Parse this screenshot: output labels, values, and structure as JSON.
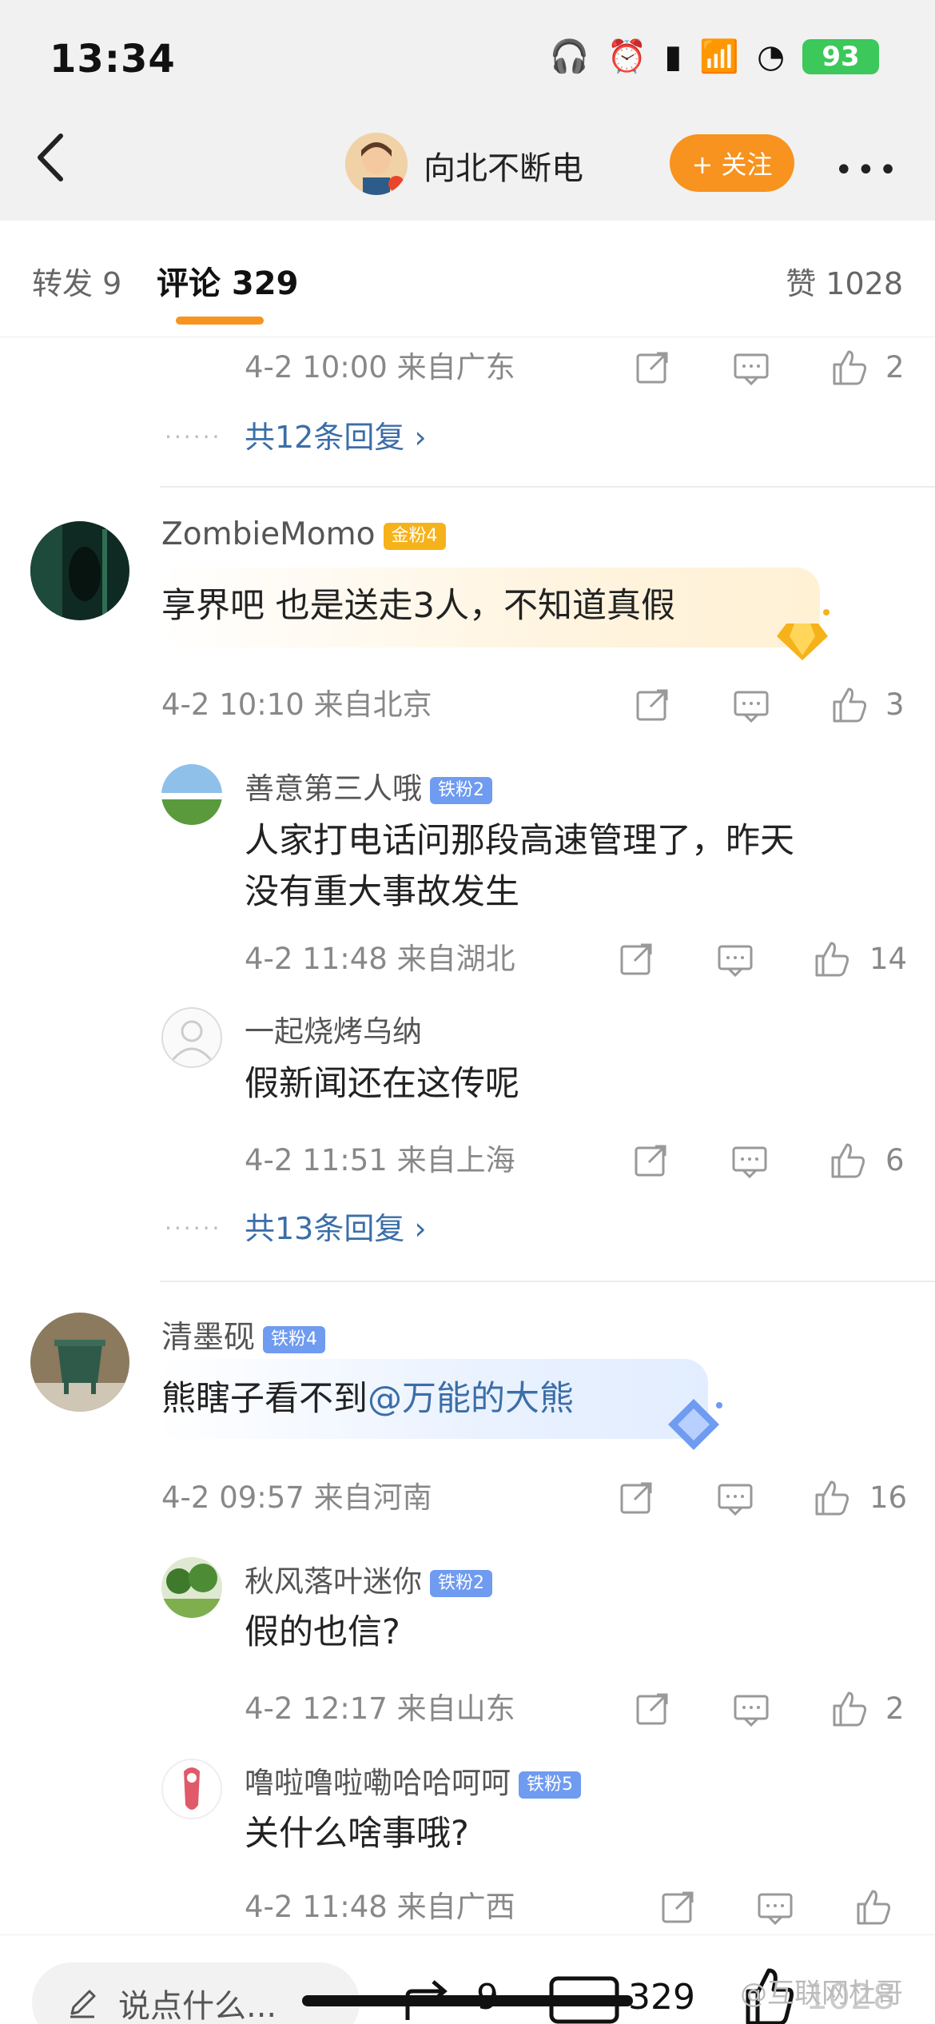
{
  "status": {
    "time": "13:34",
    "battery": "93"
  },
  "nav": {
    "username": "向北不断电",
    "follow_label": "+ 关注",
    "more": "•••"
  },
  "tabs": {
    "repost": "转发 9",
    "comment": "评论 329",
    "like": "赞 1028"
  },
  "partial_comment": {
    "meta": "4-2 10:00  来自广东",
    "likes": "2",
    "replies": "共12条回复 ›"
  },
  "comments": [
    {
      "user": "ZombieMomo",
      "badge": "金粉4",
      "text": "享界吧 也是送走3人，不知道真假",
      "meta": "4-2 10:10  来自北京",
      "likes": "3",
      "replies": [
        {
          "user": "善意第三人哦",
          "badge": "铁粉2",
          "text_line1": "人家打电话问那段高速管理了，昨天",
          "text_line2": "没有重大事故发生",
          "meta": "4-2 11:48  来自湖北",
          "likes": "14"
        },
        {
          "user": "一起烧烤乌纳",
          "badge": "",
          "text": "假新闻还在这传呢",
          "meta": "4-2 11:51  来自上海",
          "likes": "6"
        }
      ],
      "more_replies": "共13条回复 ›"
    },
    {
      "user": "清墨砚",
      "badge": "铁粉4",
      "text_plain": "熊瞎子看不到",
      "text_mention": "@万能的大熊",
      "meta": "4-2 09:57  来自河南",
      "likes": "16",
      "replies": [
        {
          "user": "秋风落叶迷你",
          "badge": "铁粉2",
          "text": "假的也信?",
          "meta": "4-2 12:17  来自山东",
          "likes": "2"
        },
        {
          "user": "噜啦噜啦嘞哈哈呵呵",
          "badge": "铁粉5",
          "text": "关什么啥事哦?",
          "meta": "4-2 11:48  来自广西",
          "likes": ""
        }
      ]
    }
  ],
  "bottom": {
    "input_placeholder": "说点什么...",
    "repost_count": "9",
    "comment_count": "329",
    "like_count": "1028",
    "watermark": "@互联网杜哥"
  },
  "colors": {
    "accent": "#f7931e",
    "link": "#3b6ea8",
    "gold_badge": "#f6b21a",
    "iron_badge": "#6f9bf0"
  }
}
